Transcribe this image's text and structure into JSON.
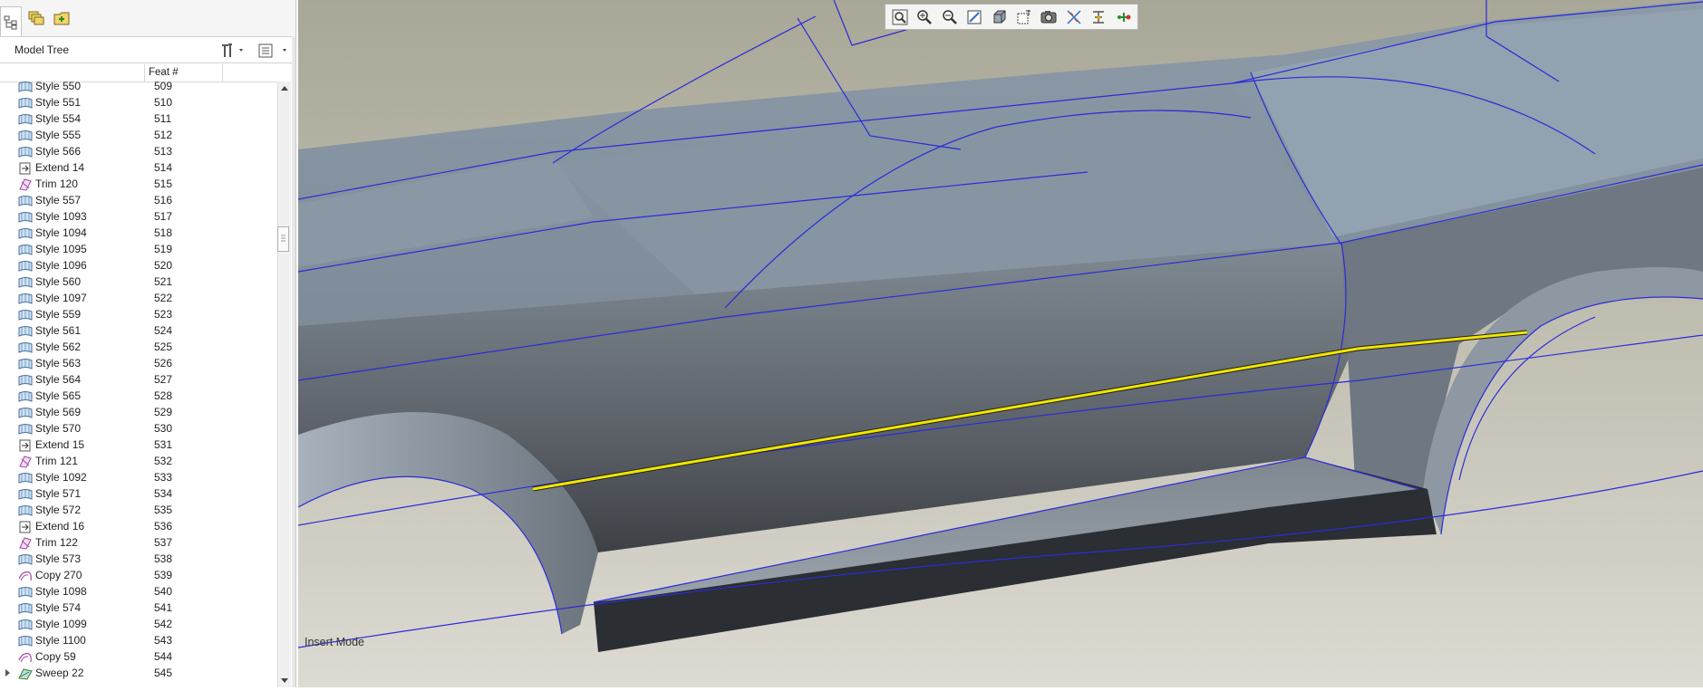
{
  "tabs": [
    {
      "icon": "model-tree-icon"
    },
    {
      "icon": "layers-icon"
    },
    {
      "icon": "folder-browser-icon"
    }
  ],
  "model_tree": {
    "title": "Model Tree",
    "column_feat": "Feat #"
  },
  "rows": [
    {
      "name": "Style 550",
      "feat": "509",
      "type": "style"
    },
    {
      "name": "Style 551",
      "feat": "510",
      "type": "style"
    },
    {
      "name": "Style 554",
      "feat": "511",
      "type": "style"
    },
    {
      "name": "Style 555",
      "feat": "512",
      "type": "style"
    },
    {
      "name": "Style 566",
      "feat": "513",
      "type": "style"
    },
    {
      "name": "Extend 14",
      "feat": "514",
      "type": "extend"
    },
    {
      "name": "Trim 120",
      "feat": "515",
      "type": "trim"
    },
    {
      "name": "Style 557",
      "feat": "516",
      "type": "style"
    },
    {
      "name": "Style 1093",
      "feat": "517",
      "type": "style"
    },
    {
      "name": "Style 1094",
      "feat": "518",
      "type": "style"
    },
    {
      "name": "Style 1095",
      "feat": "519",
      "type": "style"
    },
    {
      "name": "Style 1096",
      "feat": "520",
      "type": "style"
    },
    {
      "name": "Style 560",
      "feat": "521",
      "type": "style"
    },
    {
      "name": "Style 1097",
      "feat": "522",
      "type": "style"
    },
    {
      "name": "Style 559",
      "feat": "523",
      "type": "style"
    },
    {
      "name": "Style 561",
      "feat": "524",
      "type": "style"
    },
    {
      "name": "Style 562",
      "feat": "525",
      "type": "style"
    },
    {
      "name": "Style 563",
      "feat": "526",
      "type": "style"
    },
    {
      "name": "Style 564",
      "feat": "527",
      "type": "style"
    },
    {
      "name": "Style 565",
      "feat": "528",
      "type": "style"
    },
    {
      "name": "Style 569",
      "feat": "529",
      "type": "style"
    },
    {
      "name": "Style 570",
      "feat": "530",
      "type": "style"
    },
    {
      "name": "Extend 15",
      "feat": "531",
      "type": "extend"
    },
    {
      "name": "Trim 121",
      "feat": "532",
      "type": "trim"
    },
    {
      "name": "Style 1092",
      "feat": "533",
      "type": "style"
    },
    {
      "name": "Style 571",
      "feat": "534",
      "type": "style"
    },
    {
      "name": "Style 572",
      "feat": "535",
      "type": "style"
    },
    {
      "name": "Extend 16",
      "feat": "536",
      "type": "extend"
    },
    {
      "name": "Trim 122",
      "feat": "537",
      "type": "trim"
    },
    {
      "name": "Style 573",
      "feat": "538",
      "type": "style"
    },
    {
      "name": "Copy 270",
      "feat": "539",
      "type": "copy"
    },
    {
      "name": "Style 1098",
      "feat": "540",
      "type": "style"
    },
    {
      "name": "Style 574",
      "feat": "541",
      "type": "style"
    },
    {
      "name": "Style 1099",
      "feat": "542",
      "type": "style"
    },
    {
      "name": "Style 1100",
      "feat": "543",
      "type": "style"
    },
    {
      "name": "Copy 59",
      "feat": "544",
      "type": "copy"
    },
    {
      "name": "Sweep 22",
      "feat": "545",
      "type": "sweep"
    }
  ],
  "view_toolbar": [
    "refit-icon",
    "zoom-in-icon",
    "zoom-out-icon",
    "repaint-icon",
    "display-style-icon",
    "saved-orientations-icon",
    "view-manager-icon",
    "datum-display-icon",
    "spin-center-icon",
    "annotation-display-icon"
  ],
  "status": {
    "mode": "Insert Mode"
  },
  "colors": {
    "selection": "#e8e000",
    "edges": "#2b2bd8",
    "surface": "#7b8896"
  }
}
